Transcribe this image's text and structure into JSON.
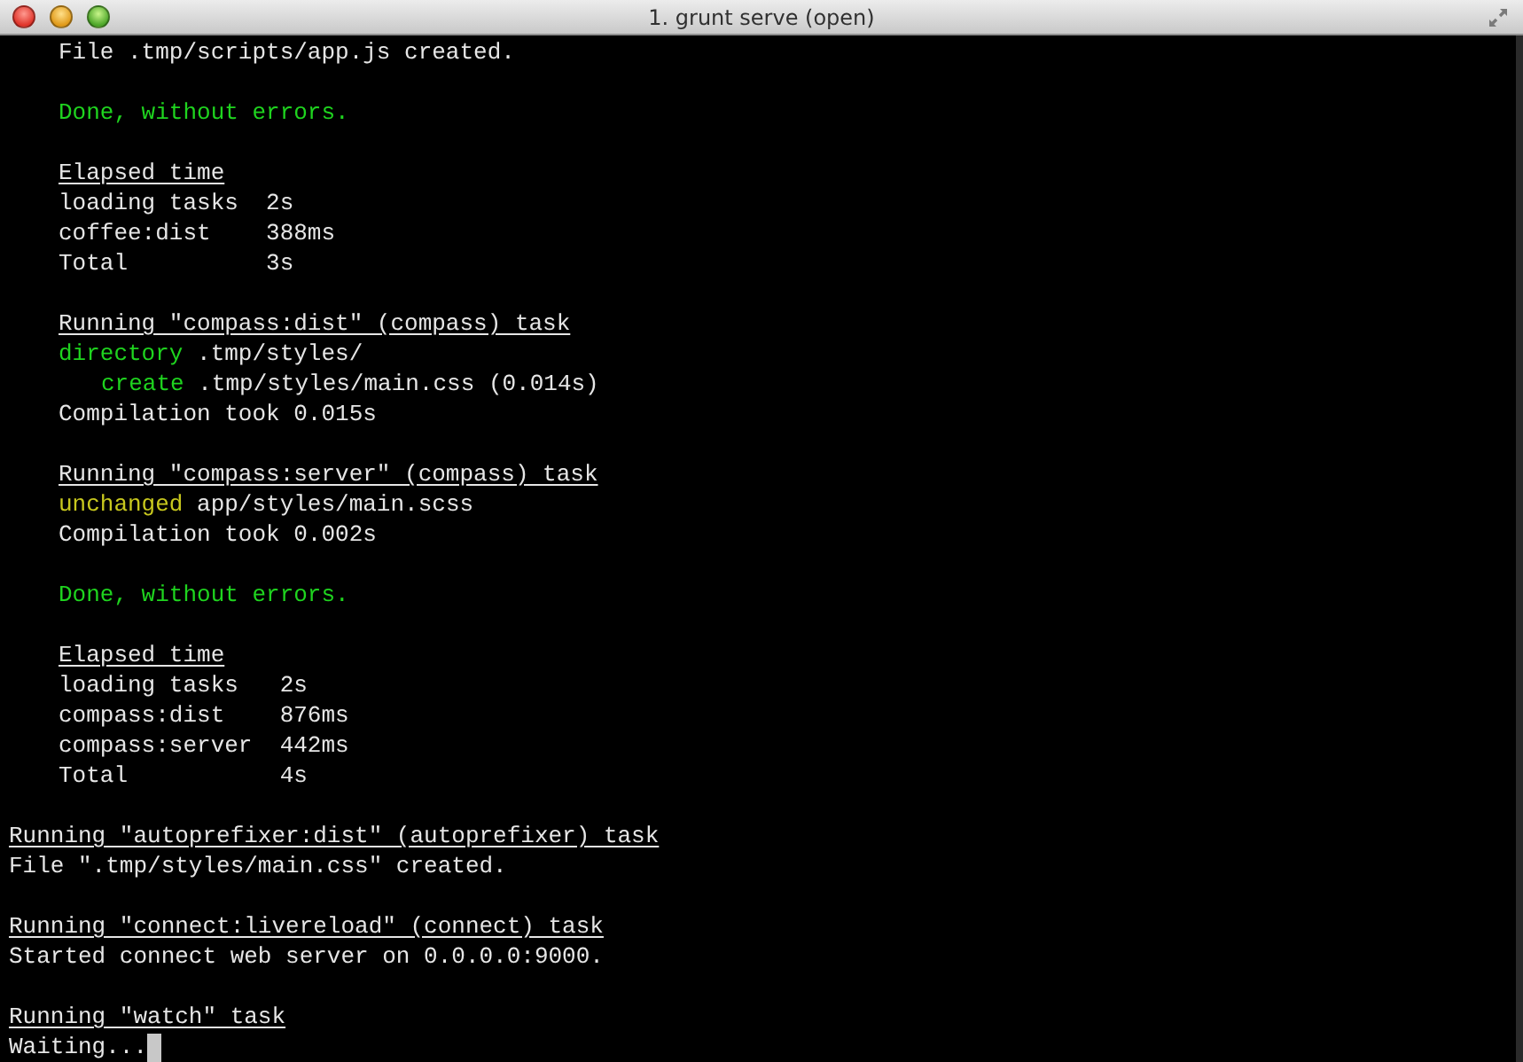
{
  "window": {
    "title": "1. grunt serve (open)"
  },
  "blocks": [
    {
      "indented": true,
      "lines": [
        {
          "nested": false,
          "segments": [
            {
              "kind": "plain",
              "text": "File .tmp/scripts/app.js created."
            }
          ]
        }
      ]
    },
    {
      "indented": true,
      "lines": [
        {
          "nested": false,
          "segments": [
            {
              "kind": "success",
              "text": "Done, without errors."
            }
          ]
        }
      ]
    },
    {
      "indented": true,
      "lines": [
        {
          "nested": false,
          "segments": [
            {
              "kind": "heading",
              "text": "Elapsed time"
            }
          ]
        },
        {
          "nested": false,
          "segments": [
            {
              "kind": "plain",
              "text": "loading tasks  2s"
            }
          ]
        },
        {
          "nested": false,
          "segments": [
            {
              "kind": "plain",
              "text": "coffee:dist    388ms"
            }
          ]
        },
        {
          "nested": false,
          "segments": [
            {
              "kind": "plain",
              "text": "Total          3s"
            }
          ]
        }
      ]
    },
    {
      "indented": true,
      "lines": [
        {
          "nested": false,
          "segments": [
            {
              "kind": "heading",
              "text": "Running \"compass:dist\" (compass) task"
            }
          ]
        },
        {
          "nested": false,
          "segments": [
            {
              "kind": "success",
              "text": "directory"
            },
            {
              "kind": "plain",
              "text": " .tmp/styles/"
            }
          ]
        },
        {
          "nested": true,
          "segments": [
            {
              "kind": "success",
              "text": "create"
            },
            {
              "kind": "plain",
              "text": " .tmp/styles/main.css (0.014s)"
            }
          ]
        },
        {
          "nested": false,
          "segments": [
            {
              "kind": "plain",
              "text": "Compilation took 0.015s"
            }
          ]
        }
      ]
    },
    {
      "indented": true,
      "lines": [
        {
          "nested": false,
          "segments": [
            {
              "kind": "heading",
              "text": "Running \"compass:server\" (compass) task"
            }
          ]
        },
        {
          "nested": false,
          "segments": [
            {
              "kind": "warning",
              "text": "unchanged"
            },
            {
              "kind": "plain",
              "text": " app/styles/main.scss"
            }
          ]
        },
        {
          "nested": false,
          "segments": [
            {
              "kind": "plain",
              "text": "Compilation took 0.002s"
            }
          ]
        }
      ]
    },
    {
      "indented": true,
      "lines": [
        {
          "nested": false,
          "segments": [
            {
              "kind": "success",
              "text": "Done, without errors."
            }
          ]
        }
      ]
    },
    {
      "indented": true,
      "lines": [
        {
          "nested": false,
          "segments": [
            {
              "kind": "heading",
              "text": "Elapsed time"
            }
          ]
        },
        {
          "nested": false,
          "segments": [
            {
              "kind": "plain",
              "text": "loading tasks   2s"
            }
          ]
        },
        {
          "nested": false,
          "segments": [
            {
              "kind": "plain",
              "text": "compass:dist    876ms"
            }
          ]
        },
        {
          "nested": false,
          "segments": [
            {
              "kind": "plain",
              "text": "compass:server  442ms"
            }
          ]
        },
        {
          "nested": false,
          "segments": [
            {
              "kind": "plain",
              "text": "Total           4s"
            }
          ]
        }
      ]
    },
    {
      "indented": false,
      "lines": [
        {
          "nested": false,
          "segments": [
            {
              "kind": "heading",
              "text": "Running \"autoprefixer:dist\" (autoprefixer) task"
            }
          ]
        },
        {
          "nested": false,
          "segments": [
            {
              "kind": "plain",
              "text": "File \".tmp/styles/main.css\" created."
            }
          ]
        }
      ]
    },
    {
      "indented": false,
      "lines": [
        {
          "nested": false,
          "segments": [
            {
              "kind": "heading",
              "text": "Running \"connect:livereload\" (connect) task"
            }
          ]
        },
        {
          "nested": false,
          "segments": [
            {
              "kind": "plain",
              "text": "Started connect web server on 0.0.0.0:9000."
            }
          ]
        }
      ]
    },
    {
      "indented": false,
      "lines": [
        {
          "nested": false,
          "segments": [
            {
              "kind": "heading",
              "text": "Running \"watch\" task"
            }
          ]
        },
        {
          "nested": false,
          "cursor": true,
          "segments": [
            {
              "kind": "plain",
              "text": "Waiting..."
            }
          ]
        }
      ]
    }
  ]
}
